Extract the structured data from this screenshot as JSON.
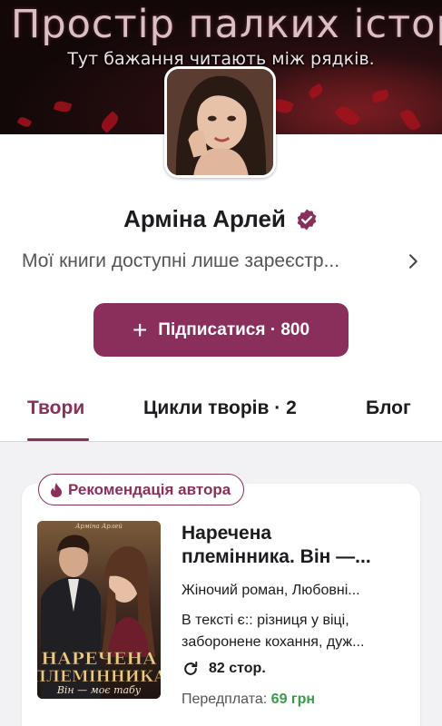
{
  "banner": {
    "title": "Простір палких історій",
    "subtitle": "Тут бажання читають між рядків."
  },
  "profile": {
    "name": "Арміна Арлей",
    "bio": "Мої книги доступні лише зареєстр...",
    "subscribe_label": "Підписатися · 800",
    "subscribe_plus": "+"
  },
  "tabs": [
    {
      "label": "Твори",
      "active": true
    },
    {
      "label": "Цикли творів · 2",
      "active": false
    },
    {
      "label": "Блог",
      "active": false
    }
  ],
  "book": {
    "badge": "Рекомендація автора",
    "title_line1": "Наречена",
    "title_line2": "племінника. Він —...",
    "genres": "Жіночий роман, Любовні...",
    "tags_line1": "В тексті є:: різниця у віці,",
    "tags_line2": "заборонене кохання, дуж...",
    "pages": "82 стор.",
    "price_label": "Передплата: ",
    "price_value": "69 грн",
    "cover_author": "Арміна Арлей",
    "cover_title_1": "НАРЕЧЕНА",
    "cover_title_2": "ПЛЕМІННИКА",
    "cover_subtitle": "Він — моє табу"
  },
  "colors": {
    "accent": "#8a2f5c",
    "price_green": "#3a9a4a"
  },
  "icons": {
    "verified": "verified-badge-icon",
    "chevron": "chevron-right-icon",
    "flame": "flame-icon",
    "pages": "refresh-icon"
  }
}
